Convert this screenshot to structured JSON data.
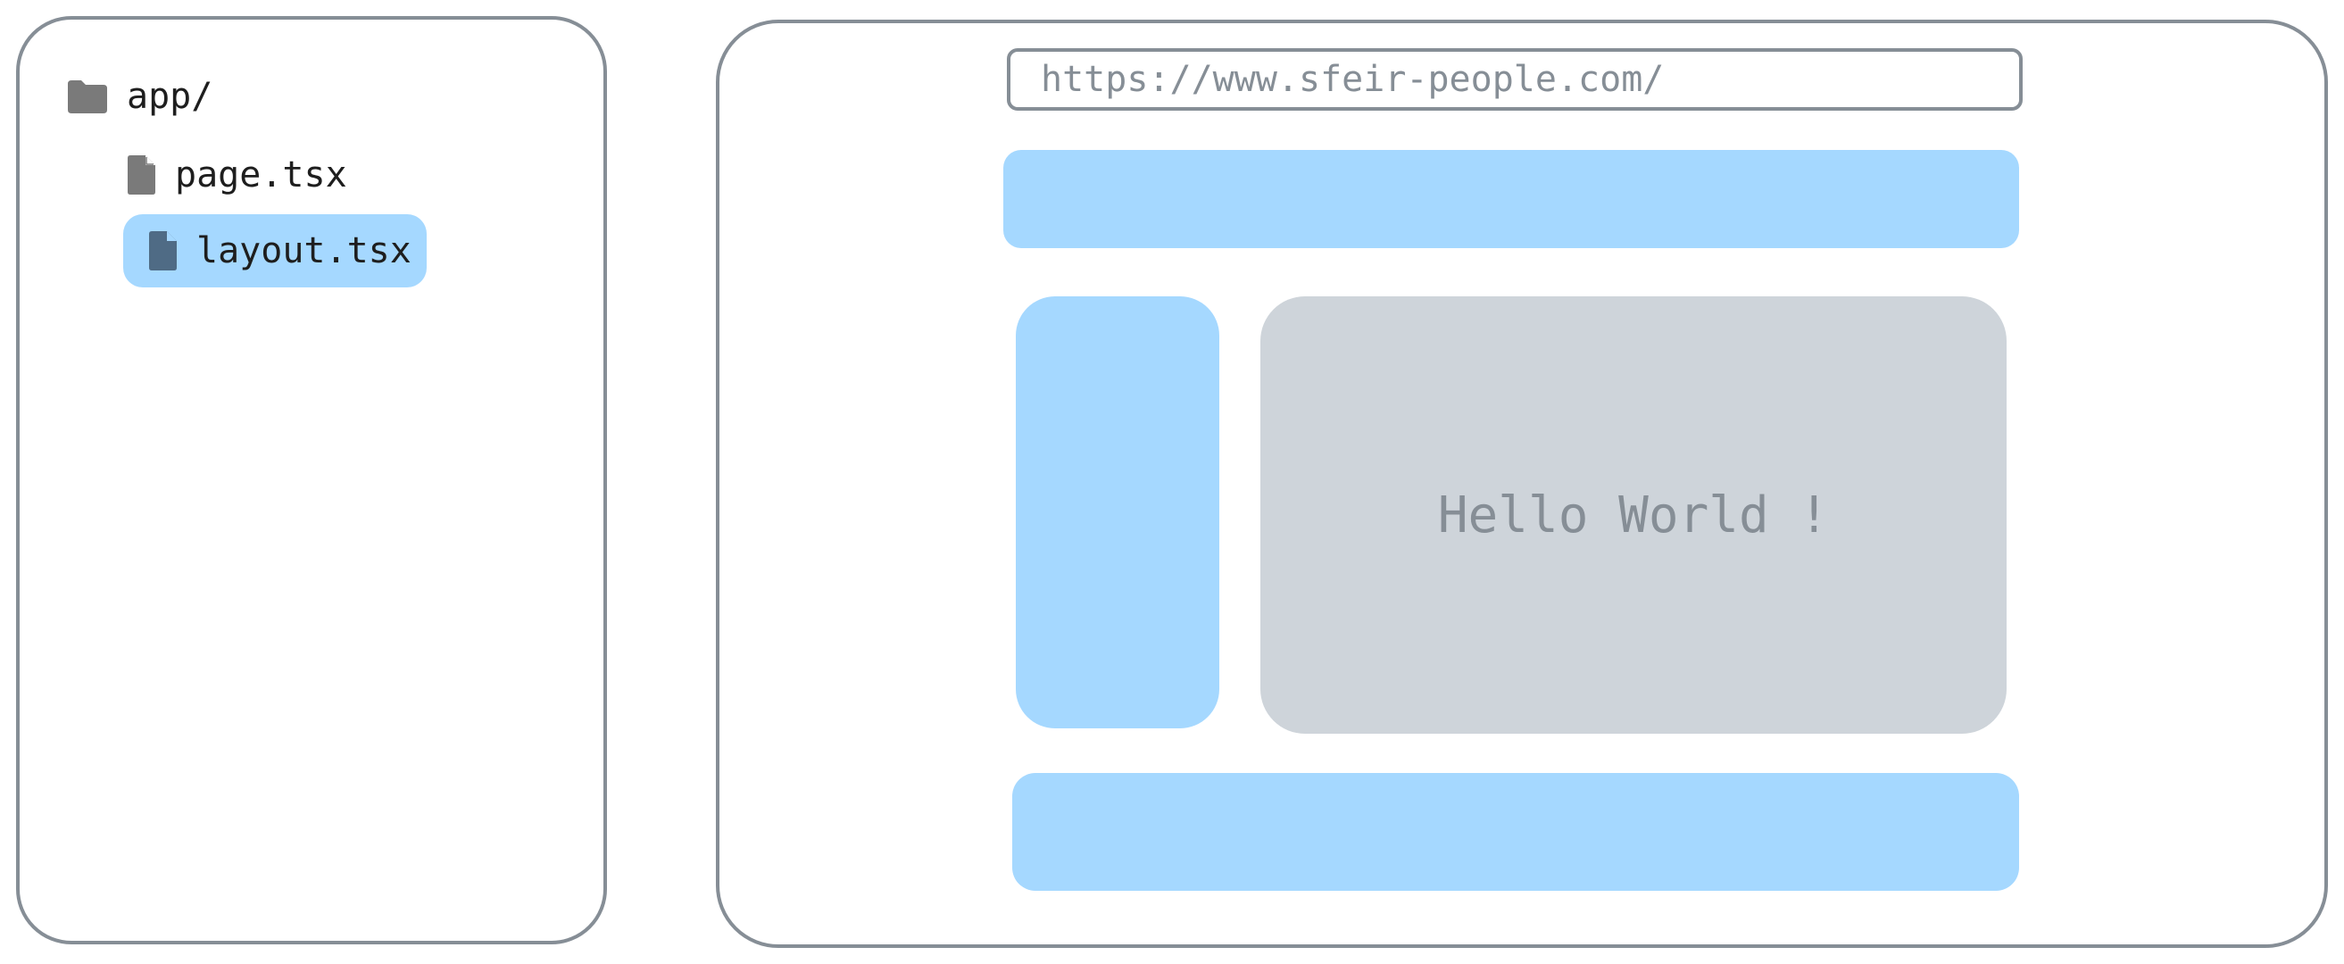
{
  "file_tree": {
    "folder": {
      "label": "app/",
      "icon": "folder-icon"
    },
    "files": [
      {
        "label": "page.tsx",
        "icon": "file-icon",
        "selected": false
      },
      {
        "label": "layout.tsx",
        "icon": "file-icon",
        "selected": true
      }
    ]
  },
  "browser": {
    "url": "https://www.sfeir-people.com/",
    "content_text": "Hello World !"
  },
  "colors": {
    "outline": "#868e96",
    "highlight": "#a5d8ff",
    "content_fill": "#ced4da",
    "icon_gray": "#7a7a7a",
    "icon_selected": "#4f6b85"
  }
}
